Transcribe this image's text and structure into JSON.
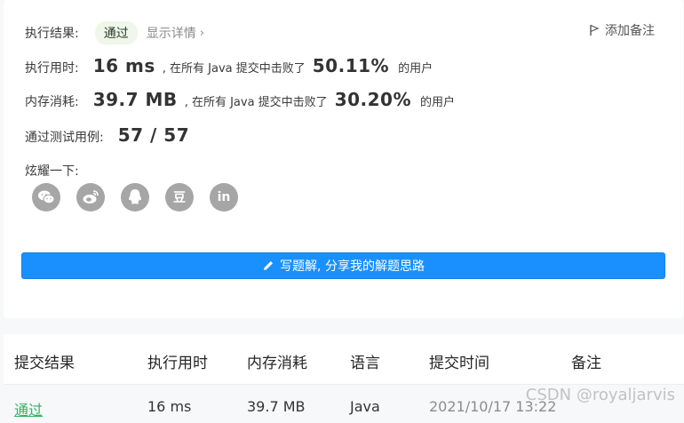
{
  "result": {
    "label": "执行结果:",
    "status": "通过",
    "detail_link": "显示详情",
    "add_note": "添加备注"
  },
  "runtime": {
    "label": "执行用时:",
    "value": "16 ms",
    "middle": ", 在所有 Java 提交中击败了",
    "percent": "50.11%",
    "suffix": "的用户"
  },
  "memory": {
    "label": "内存消耗:",
    "value": "39.7 MB",
    "middle": ", 在所有 Java 提交中击败了",
    "percent": "30.20%",
    "suffix": "的用户"
  },
  "tests": {
    "label": "通过测试用例:",
    "value": "57 / 57"
  },
  "share": {
    "label": "炫耀一下:",
    "items": [
      {
        "icon": "wechat-icon",
        "glyph": ""
      },
      {
        "icon": "weibo-icon",
        "glyph": ""
      },
      {
        "icon": "qq-icon",
        "glyph": ""
      },
      {
        "icon": "douban-icon",
        "glyph": "豆"
      },
      {
        "icon": "linkedin-icon",
        "glyph": "in"
      }
    ]
  },
  "solution_button": "写题解, 分享我的解题思路",
  "table": {
    "headers": [
      "提交结果",
      "执行用时",
      "内存消耗",
      "语言",
      "提交时间",
      "备注"
    ],
    "rows": [
      {
        "status": "通过",
        "runtime": "16 ms",
        "memory": "39.7 MB",
        "language": "Java",
        "time": "2021/10/17 13:22"
      }
    ]
  },
  "watermark": "CSDN @royaljarvis",
  "colors": {
    "accent": "#1a90ff",
    "pass": "#2db55d"
  }
}
